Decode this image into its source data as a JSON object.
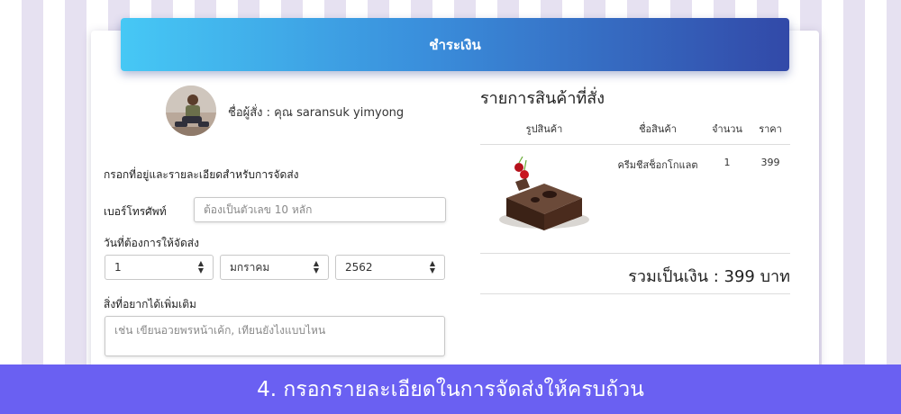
{
  "header": {
    "title": "ชำระเงิน"
  },
  "customer": {
    "name_label": "ชื่อผู้สั่ง : คุณ saransuk yimyong"
  },
  "form": {
    "section_title": "กรอกที่อยู่และรายละเอียดสำหรับการจัดส่ง",
    "phone_label": "เบอร์โทรศัพท์",
    "phone_placeholder": "ต้องเป็นตัวเลข 10 หลัก",
    "date_label": "วันที่ต้องการให้จัดส่ง",
    "day_value": "1",
    "month_value": "มกราคม",
    "year_value": "2562",
    "notes_label": "สิ่งที่อยากได้เพิ่มเติม",
    "notes_placeholder": "เช่น เขียนอวยพรหน้าเค้ก, เทียนยังไงแบบไหน"
  },
  "order": {
    "title": "รายการสินค้าที่สั่ง",
    "columns": [
      "รูปสินค้า",
      "ชื่อสินค้า",
      "จำนวน",
      "ราคา"
    ],
    "items": [
      {
        "image_icon": "chocolate-cake-image",
        "name": "ครีมชีสช็อกโกแลต",
        "qty": "1",
        "price": "399"
      }
    ],
    "total": "รวมเป็นเงิน : 399 บาท"
  },
  "banner": {
    "text": "4. กรอกรายละเอียดในการจัดส่งให้ครบถ้วน"
  },
  "colors": {
    "header_gradient": [
      "#46c8f5",
      "#3249a8"
    ],
    "banner": "#6a60f2",
    "stripe": "#e6e1f1"
  }
}
